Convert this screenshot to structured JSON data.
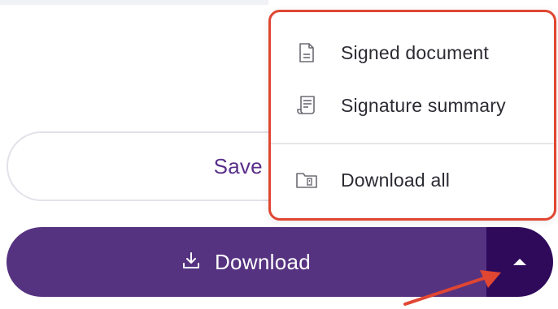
{
  "buttons": {
    "save_label": "Save to Do",
    "download_label": "Download"
  },
  "menu": {
    "items": [
      {
        "label": "Signed document",
        "icon": "document-icon"
      },
      {
        "label": "Signature summary",
        "icon": "receipt-icon"
      },
      {
        "label": "Download all",
        "icon": "folder-zip-icon"
      }
    ]
  },
  "colors": {
    "primary": "#563380",
    "primary_dark": "#2f0a5b",
    "accent_text": "#5a2f8a",
    "highlight": "#e04632"
  },
  "icons": {
    "download": "download-icon",
    "caret": "caret-up-icon",
    "annotation": "annotation-arrow"
  }
}
